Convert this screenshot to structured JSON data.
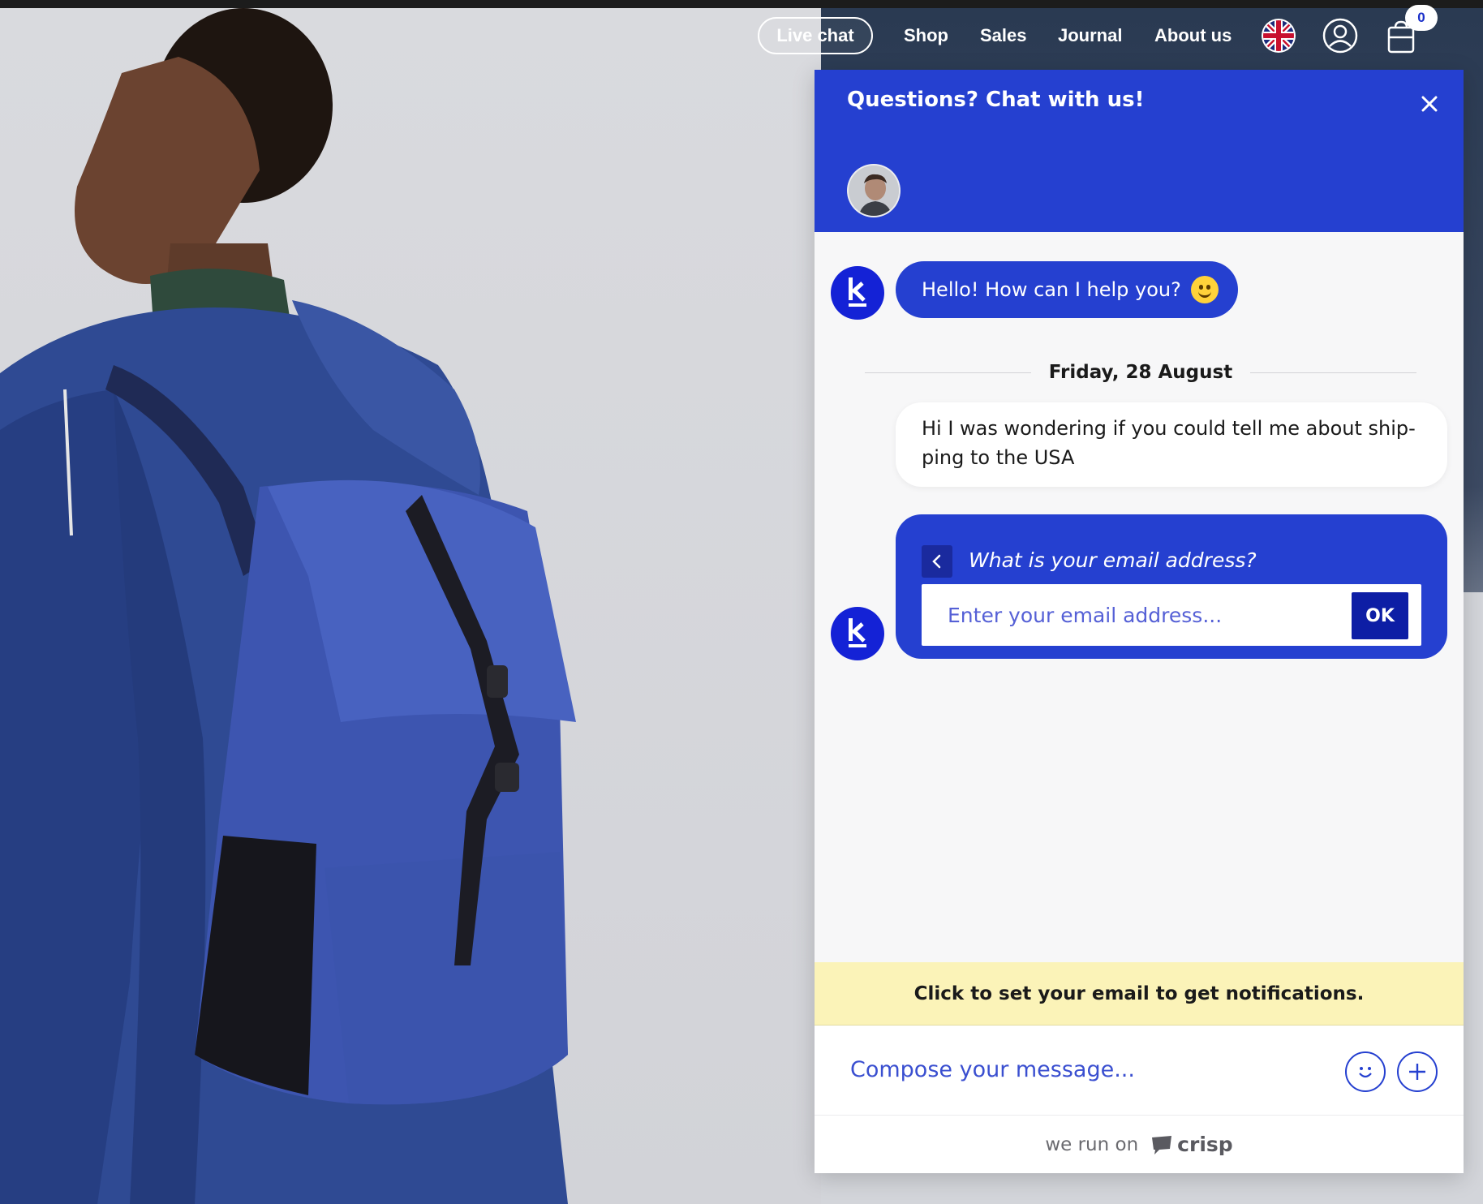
{
  "nav": {
    "live_chat": "Live chat",
    "links": [
      "Shop",
      "Sales",
      "Journal",
      "About us"
    ],
    "icons": [
      "uk-flag-icon",
      "account-icon",
      "cart-icon"
    ],
    "cart_count": "0"
  },
  "chat": {
    "title": "Questions? Chat with us!",
    "greeting": "Hello! How can I help you?",
    "date_separator": "Friday, 28 August",
    "user_message": "Hi I was wondering if you could tell me about ship-ping to the USA",
    "user_message_lines": [
      "Hi I was wondering if you could tell me about ship-",
      "ping to the USA"
    ],
    "email_prompt": "What is your email address?",
    "email_placeholder": "Enter your email address...",
    "ok_label": "OK",
    "notification_text": "Click to set your email to get notifications.",
    "compose_placeholder": "Compose your message...",
    "footer_prefix": "we run on",
    "footer_brand": "crisp"
  },
  "colors": {
    "accent": "#2540d0",
    "accent_dark": "#0d1ea5",
    "notification_bg": "#fbf3b8",
    "panel_bg": "#f7f7f8"
  }
}
